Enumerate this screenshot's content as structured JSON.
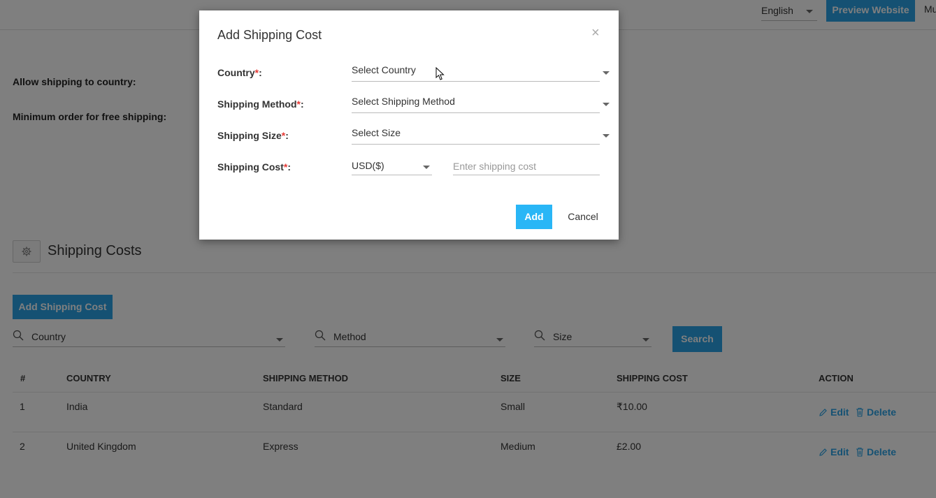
{
  "topbar": {
    "language": "English",
    "preview_label": "Preview Website",
    "user_truncated": "Mu"
  },
  "settings": {
    "allow_shipping_label": "Allow shipping to country:",
    "min_order_label": "Minimum order for free shipping:"
  },
  "section": {
    "title": "Shipping Costs",
    "add_button": "Add Shipping Cost"
  },
  "filters": {
    "country": "Country",
    "method": "Method",
    "size": "Size",
    "search_label": "Search"
  },
  "table": {
    "headers": [
      "#",
      "COUNTRY",
      "SHIPPING METHOD",
      "SIZE",
      "SHIPPING COST",
      "ACTION"
    ],
    "rows": [
      {
        "num": "1",
        "country": "India",
        "method": "Standard",
        "size": "Small",
        "cost": "₹10.00"
      },
      {
        "num": "2",
        "country": "United Kingdom",
        "method": "Express",
        "size": "Medium",
        "cost": "£2.00"
      }
    ],
    "edit_label": "Edit",
    "delete_label": "Delete"
  },
  "modal": {
    "title": "Add Shipping Cost",
    "close": "×",
    "country_label": "Country",
    "method_label": "Shipping Method",
    "size_label": "Shipping Size",
    "cost_label": "Shipping Cost",
    "required_mark": "*",
    "colon": ":",
    "country_value": "Select Country",
    "method_value": "Select Shipping Method",
    "size_value": "Select Size",
    "currency_value": "USD($)",
    "cost_placeholder": "Enter shipping cost",
    "add_label": "Add",
    "cancel_label": "Cancel"
  },
  "colors": {
    "accent": "#2aa3e6",
    "modal_accent": "#29b6f6",
    "required": "#e53935"
  }
}
